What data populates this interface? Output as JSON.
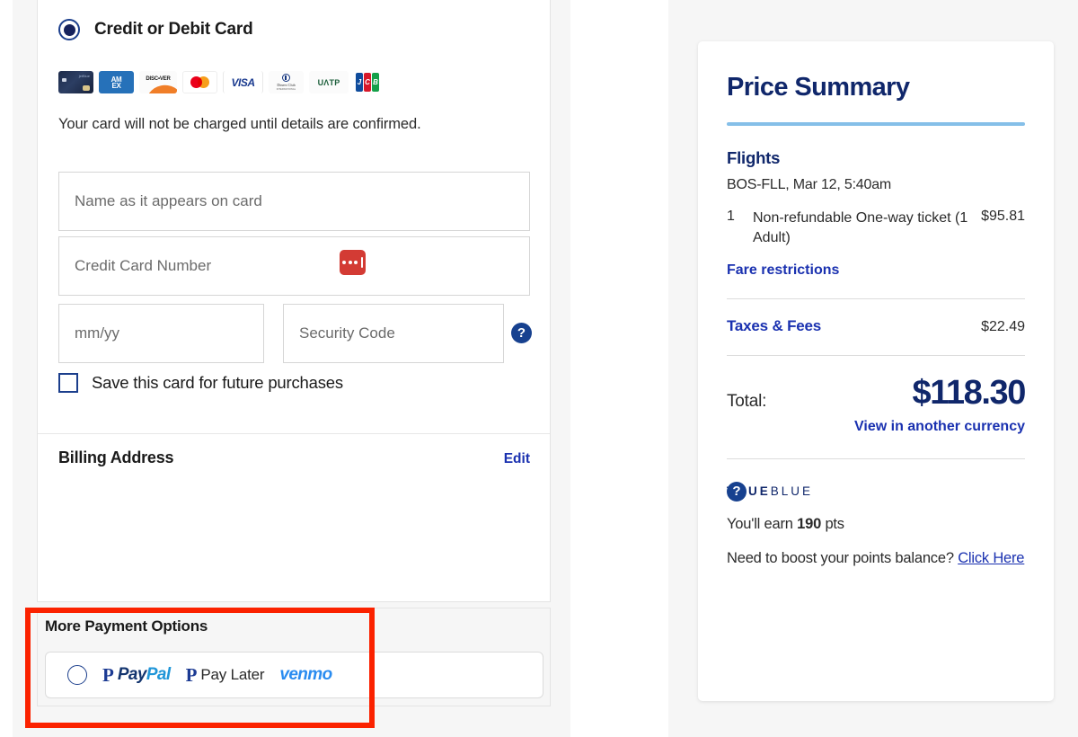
{
  "payment": {
    "credit_option_label": "Credit or Debit Card",
    "card_logos": [
      {
        "name": "generic-card",
        "text": "jetBlue"
      },
      {
        "name": "amex",
        "line1": "AM",
        "line2": "EX"
      },
      {
        "name": "discover",
        "text": "DISC•VER"
      },
      {
        "name": "mastercard",
        "text": ""
      },
      {
        "name": "visa",
        "text": "VISA"
      },
      {
        "name": "diners-club",
        "line1": "Diners Club",
        "line2": "INTERNATIONAL"
      },
      {
        "name": "uatp",
        "text": "UΛTP"
      },
      {
        "name": "jcb",
        "l1": "J",
        "l2": "C",
        "l3": "B"
      }
    ],
    "charge_note": "Your card will not be charged until details are confirmed.",
    "name_placeholder": "Name as it appears on card",
    "name_value": "",
    "ccnum_placeholder": "Credit Card Number",
    "ccnum_value": "",
    "expiry_placeholder": "mm/yy",
    "expiry_value": "",
    "cvv_placeholder": "Security Code",
    "cvv_value": "",
    "cvv_help_glyph": "?",
    "save_card_label": "Save this card for future purchases",
    "billing_title": "Billing Address",
    "billing_edit": "Edit",
    "lastpass_icon": "lastpass-icon"
  },
  "more_payment": {
    "title": "More Payment Options",
    "paypal_mark": "P",
    "paypal_word_a": "Pay",
    "paypal_word_b": "Pal",
    "paylater_mark": "P",
    "paylater_label": "Pay Later",
    "venmo_label": "venmo"
  },
  "summary": {
    "title": "Price Summary",
    "flights_heading": "Flights",
    "route": "BOS-FLL, Mar 12, 5:40am",
    "item_qty": "1",
    "item_desc": "Non-refundable One-way ticket (1 Adult)",
    "item_price": "$95.81",
    "fare_restrictions": "Fare restrictions",
    "taxes_label": "Taxes & Fees",
    "taxes_value": "$22.49",
    "total_label": "Total:",
    "total_value": "$118.30",
    "currency_link": "View in another currency",
    "trueblue_bold": "TRUE",
    "trueblue_light": "BLUE",
    "trueblue_help_glyph": "?",
    "earn_prefix": "You'll earn ",
    "earn_points": "190",
    "earn_suffix": " pts",
    "boost_text": "Need to boost your points balance? ",
    "boost_link": "Click Here"
  },
  "colors": {
    "navy": "#10276b",
    "link_blue": "#1a31b0",
    "accent_rule": "#85bfe8",
    "highlight_box": "#fb2200",
    "lastpass_red": "#d33b34",
    "page_bg": "#f6f6f6"
  }
}
